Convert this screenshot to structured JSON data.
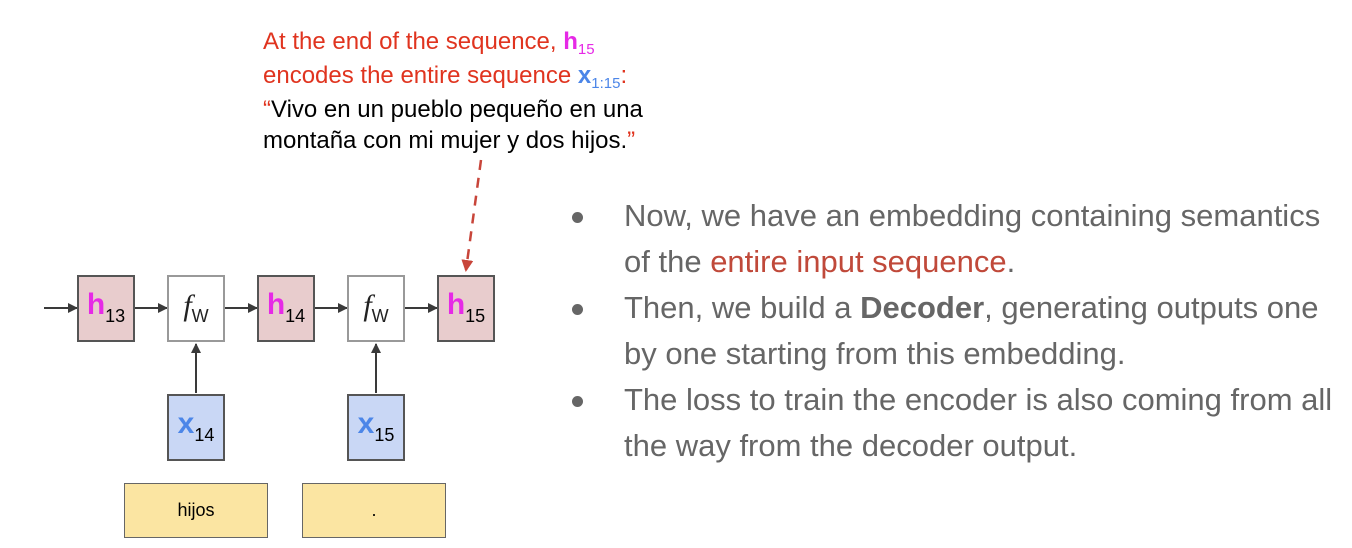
{
  "annotation": {
    "line1_text": "At the end of the sequence, ",
    "line1_h": "h",
    "line1_h_sub": "15",
    "line2_text": "encodes the entire sequence ",
    "line2_x": "x",
    "line2_x_sub": "1:15",
    "line2_colon": ":",
    "quote_open": "“",
    "quote_line1": "Vivo en un pueblo pequeño en una",
    "quote_line2": "montaña con mi mujer y dos hijos.",
    "quote_close": "”"
  },
  "diagram": {
    "h_nodes": [
      {
        "symbol": "h",
        "sub": "13"
      },
      {
        "symbol": "h",
        "sub": "14"
      },
      {
        "symbol": "h",
        "sub": "15"
      }
    ],
    "f_nodes": [
      {
        "symbol": "f",
        "sub": "W"
      },
      {
        "symbol": "f",
        "sub": "W"
      }
    ],
    "x_nodes": [
      {
        "symbol": "x",
        "sub": "14"
      },
      {
        "symbol": "x",
        "sub": "15"
      }
    ],
    "words": [
      "hijos",
      "."
    ]
  },
  "bullets": {
    "b1_part1": "Now, we have an embedding containing semantics of the ",
    "b1_highlight": "entire input sequence",
    "b1_part2": ".",
    "b2_part1": "Then, we build a ",
    "b2_bold": "Decoder",
    "b2_part2": ", generating outputs one by one starting from this embedding.",
    "b3": "The loss to train the encoder is also coming from all the way from the decoder output."
  },
  "colors": {
    "annotation_red": "#e0341f",
    "h_magenta": "#e629e6",
    "x_blue": "#4c86e8",
    "h_box_fill": "#e8cccd",
    "x_box_fill": "#c9d7f5",
    "word_box_fill": "#fbe5a2",
    "bullet_text": "#666666",
    "bullet_highlight": "#c0493a"
  }
}
